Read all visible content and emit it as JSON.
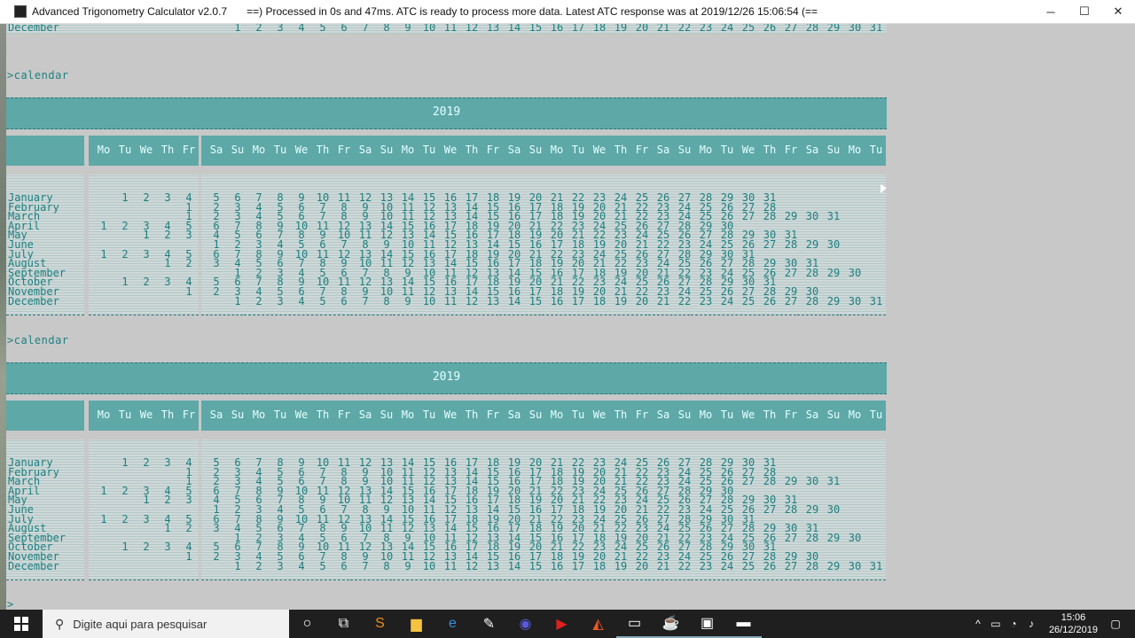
{
  "window": {
    "title": "Advanced Trigonometry Calculator v2.0.7",
    "status": "==) Processed in 0s and 47ms. ATC is ready to process more data. Latest ATC response was at 2019/12/26 15:06:54 (=="
  },
  "terminal": {
    "command": ">calendar",
    "bottom_prompt": ">",
    "calendar": {
      "year": "2019",
      "day_names": [
        "Mo",
        "Tu",
        "We",
        "Th",
        "Fr",
        "Sa",
        "Su",
        "Mo",
        "Tu",
        "We",
        "Th",
        "Fr",
        "Sa",
        "Su",
        "Mo",
        "Tu",
        "We",
        "Th",
        "Fr",
        "Sa",
        "Su",
        "Mo",
        "Tu",
        "We",
        "Th",
        "Fr",
        "Sa",
        "Su",
        "Mo",
        "Tu",
        "We",
        "Th",
        "Fr",
        "Sa",
        "Su",
        "Mo",
        "Tu"
      ],
      "months": [
        {
          "name": "January",
          "start": 1,
          "days": 31
        },
        {
          "name": "February",
          "start": 4,
          "days": 28
        },
        {
          "name": "March",
          "start": 4,
          "days": 31
        },
        {
          "name": "April",
          "start": 0,
          "days": 30
        },
        {
          "name": "May",
          "start": 2,
          "days": 31
        },
        {
          "name": "June",
          "start": 5,
          "days": 30
        },
        {
          "name": "July",
          "start": 0,
          "days": 31
        },
        {
          "name": "August",
          "start": 3,
          "days": 31
        },
        {
          "name": "September",
          "start": 6,
          "days": 30
        },
        {
          "name": "October",
          "start": 1,
          "days": 31
        },
        {
          "name": "November",
          "start": 4,
          "days": 30
        },
        {
          "name": "December",
          "start": 6,
          "days": 31
        }
      ],
      "previous_last_row": "December"
    }
  },
  "taskbar": {
    "search_placeholder": "Digite aqui para pesquisar",
    "time": "15:06",
    "date": "26/12/2019",
    "apps": [
      "cortana-icon",
      "task-view-icon",
      "sublime-icon",
      "file-explorer-icon",
      "browser-edge-icon",
      "paint-icon",
      "media-icon",
      "youtube-icon",
      "brave-icon",
      "terminal-icon",
      "java-icon",
      "atc-icon",
      "console-icon"
    ]
  },
  "colors": {
    "accent": "#5ea8a8",
    "text": "#1d7f7f"
  }
}
